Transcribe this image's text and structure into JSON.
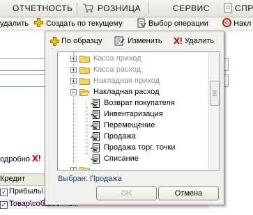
{
  "menu": {
    "items": [
      "ОТЧЕТНОСТЬ",
      "РОЗНИЦА",
      "СЕРВИС",
      "СПР"
    ]
  },
  "toolbar": {
    "delete_partial": "удалить",
    "create_by_current": "Создать по текущему",
    "select_operation": "Выбор операции",
    "invoice_partial": "Накл"
  },
  "background": {
    "detail_partial": "одробно",
    "credit_label": "Кредит",
    "row1": "Прибыль\\",
    "row2": "Товар\\собственный"
  },
  "dialog": {
    "toolbar": {
      "by_sample": "По образцу",
      "edit": "Изменить",
      "delete": "Удалить"
    },
    "tree": {
      "folders": [
        {
          "label": "Касса приход",
          "state": "collapsed",
          "muted": true
        },
        {
          "label": "Касса расход",
          "state": "collapsed",
          "muted": true
        },
        {
          "label": "Накладная приход",
          "state": "collapsed",
          "muted": true
        },
        {
          "label": "Накладная расход",
          "state": "expanded",
          "muted": false
        }
      ],
      "documents": [
        "Возврат покупателя",
        "Инвентаризация",
        "Перемещение",
        "Продажа",
        "Продажа торг. точки",
        "Списание"
      ]
    },
    "selected_label": "Выбран:",
    "selected_value": "Продажа",
    "ok_button": "OK",
    "cancel_button": "Отмена"
  },
  "colors": {
    "accent_blue": "#1f3f8f",
    "folder_yellow": "#f2d46a",
    "delete_red": "#cc1111",
    "add_yellow": "#f2c200"
  }
}
